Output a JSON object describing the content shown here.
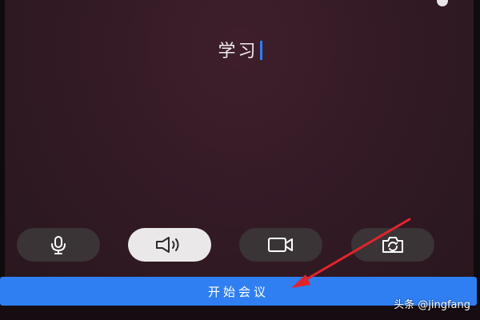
{
  "meeting": {
    "title_input_value": "学习"
  },
  "controls": [
    {
      "icon": "microphone-icon",
      "active": false
    },
    {
      "icon": "speaker-icon",
      "active": true
    },
    {
      "icon": "video-camera-icon",
      "active": false
    },
    {
      "icon": "switch-camera-icon",
      "active": false
    }
  ],
  "start_button": {
    "label": "开始会议"
  },
  "watermark": {
    "text": "头条 @jingfang"
  },
  "colors": {
    "accent": "#2f7ff2",
    "annotation_arrow": "#e0242c"
  }
}
